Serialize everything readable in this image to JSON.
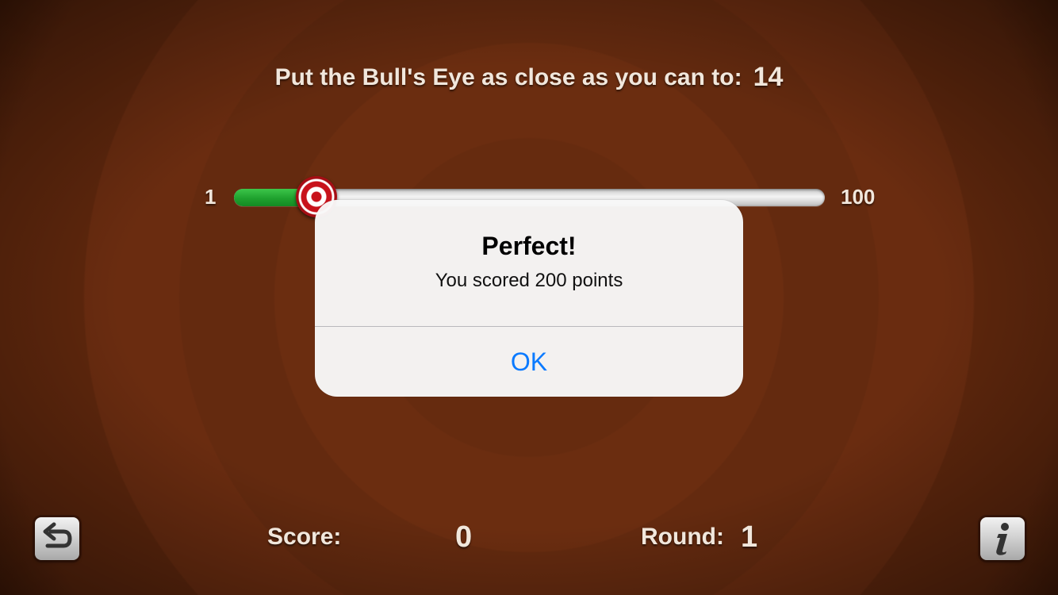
{
  "prompt": {
    "text": "Put the Bull's Eye as close as you can to:",
    "target": "14"
  },
  "slider": {
    "min_label": "1",
    "max_label": "100",
    "value_fraction": 0.14,
    "fill_color": "#1fa12e",
    "thumb_color": "#c8121b"
  },
  "alert": {
    "title": "Perfect!",
    "message": "You scored 200 points",
    "button_label": "OK",
    "button_color": "#0a7aff"
  },
  "footer": {
    "score_label": "Score:",
    "score_value": "0",
    "round_label": "Round:",
    "round_value": "1",
    "start_over_icon": "undo-arrow-icon",
    "info_icon": "info-icon"
  },
  "colors": {
    "background": "#6e2f10",
    "label_text": "#f1e7dc"
  }
}
